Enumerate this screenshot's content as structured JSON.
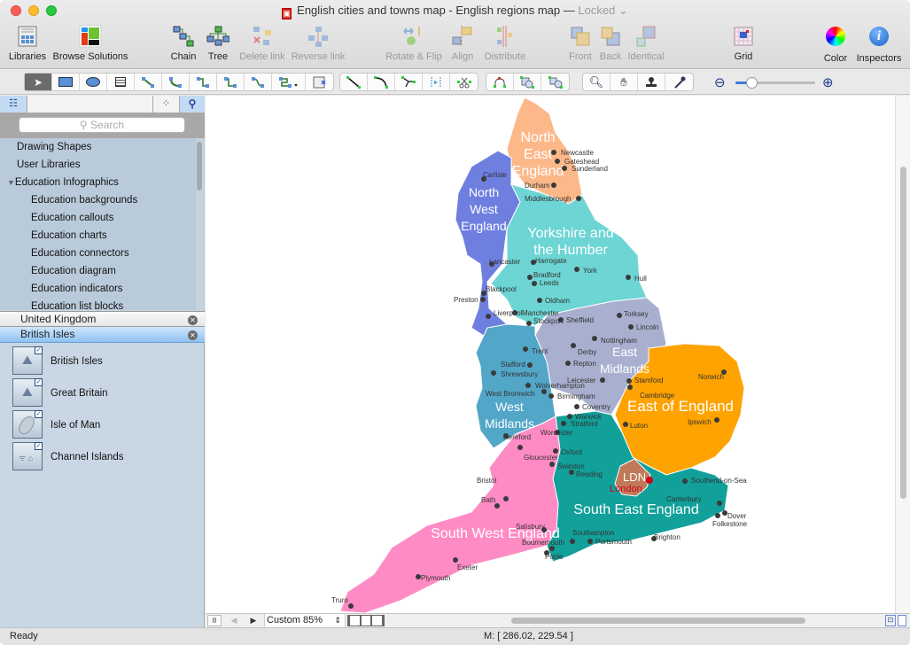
{
  "window": {
    "title": "English cities and towns map - English regions map",
    "separator": "—",
    "locked": "Locked ⌄"
  },
  "toolbar": {
    "items": [
      {
        "label": "Libraries",
        "icon": "libraries-icon",
        "enabled": true
      },
      {
        "label": "Browse Solutions",
        "icon": "browse-solutions-icon",
        "enabled": true
      },
      {
        "label": "Chain",
        "icon": "chain-icon",
        "enabled": true
      },
      {
        "label": "Tree",
        "icon": "tree-icon",
        "enabled": true
      },
      {
        "label": "Delete link",
        "icon": "delete-link-icon",
        "enabled": false
      },
      {
        "label": "Reverse link",
        "icon": "reverse-link-icon",
        "enabled": false
      },
      {
        "label": "Rotate & Flip",
        "icon": "rotate-flip-icon",
        "enabled": false
      },
      {
        "label": "Align",
        "icon": "align-icon",
        "enabled": false
      },
      {
        "label": "Distribute",
        "icon": "distribute-icon",
        "enabled": false
      },
      {
        "label": "Front",
        "icon": "front-icon",
        "enabled": false
      },
      {
        "label": "Back",
        "icon": "back-icon",
        "enabled": false
      },
      {
        "label": "Identical",
        "icon": "identical-icon",
        "enabled": false
      },
      {
        "label": "Grid",
        "icon": "grid-icon",
        "enabled": true
      },
      {
        "label": "Color",
        "icon": "color-wheel-icon",
        "enabled": true
      },
      {
        "label": "Inspectors",
        "icon": "info-icon",
        "enabled": true
      }
    ]
  },
  "tools": {
    "zoom_slider_value": 0.2
  },
  "sidebar": {
    "search_placeholder": "Search",
    "tree": [
      {
        "label": "Drawing Shapes",
        "level": 0
      },
      {
        "label": "User Libraries",
        "level": 0
      },
      {
        "label": "Education Infographics",
        "level": 0,
        "expanded": true
      },
      {
        "label": "Education backgrounds",
        "level": 1
      },
      {
        "label": "Education callouts",
        "level": 1
      },
      {
        "label": "Education charts",
        "level": 1
      },
      {
        "label": "Education connectors",
        "level": 1
      },
      {
        "label": "Education diagram",
        "level": 1
      },
      {
        "label": "Education indicators",
        "level": 1
      },
      {
        "label": "Education list blocks",
        "level": 1
      }
    ],
    "libraries": [
      {
        "label": "United Kingdom",
        "selected": false
      },
      {
        "label": "British Isles",
        "selected": true
      }
    ],
    "shapes": [
      "British Isles",
      "Great Britain",
      "Isle of Man",
      "Channel Islands"
    ]
  },
  "map": {
    "regions": [
      {
        "name": "North East England",
        "lines": [
          "North",
          "East",
          "England"
        ],
        "color": "#fdb88a"
      },
      {
        "name": "North West England",
        "lines": [
          "North",
          "West",
          "England"
        ],
        "color": "#6f7fe0"
      },
      {
        "name": "Yorkshire and the Humber",
        "lines": [
          "Yorkshire and",
          "the Humber"
        ],
        "color": "#6dd5d4"
      },
      {
        "name": "East Midlands",
        "lines": [
          "East",
          "Midlands"
        ],
        "color": "#a9b0cf"
      },
      {
        "name": "West Midlands",
        "lines": [
          "West",
          "Midlands"
        ],
        "color": "#52a6c8"
      },
      {
        "name": "East of England",
        "lines": [
          "East of England"
        ],
        "color": "#ffa300"
      },
      {
        "name": "London",
        "lines": [
          "LDN"
        ],
        "color": "#c07a5a"
      },
      {
        "name": "South East England",
        "lines": [
          "South East England"
        ],
        "color": "#12a09a"
      },
      {
        "name": "South West England",
        "lines": [
          "South West England"
        ],
        "color": "#ff8bc4"
      }
    ],
    "cities": [
      "Newcastle",
      "Gateshead",
      "Sunderland",
      "Carlisle",
      "Durham",
      "Middlesbrough",
      "Lancaster",
      "Harrogate",
      "York",
      "Bradford",
      "Leeds",
      "Hull",
      "Blackpool",
      "Preston",
      "Oldham",
      "Manchester",
      "Liverpool",
      "Sheffield",
      "Stockport",
      "Torksey",
      "Lincoln",
      "Nottingham",
      "Trent",
      "Derby",
      "Repton",
      "Stafford",
      "Shrewsbury",
      "Leicester",
      "Stamford",
      "Wolverhampton",
      "West Bromwich",
      "Birmingham",
      "Coventry",
      "Warwick",
      "Stratford",
      "Worcester",
      "Hereford",
      "Norwich",
      "Cambridge",
      "Luton",
      "Ipswich",
      "Gloucester",
      "Oxford",
      "Swindon",
      "Reading",
      "Bristol",
      "Bath",
      "Southend-on-Sea",
      "Canterbury",
      "Dover",
      "Folkestone",
      "Salisbury",
      "Southampton",
      "Portsmouth",
      "Brighton",
      "Bournemouth",
      "Poole",
      "Exeter",
      "Plymouth",
      "Truro"
    ],
    "capital_label": "London",
    "capital_color": "#d0021b"
  },
  "bottom_bar": {
    "zoom_label": "Custom 85%"
  },
  "status": {
    "left": "Ready",
    "coords": "M: [ 286.02, 229.54 ]"
  }
}
